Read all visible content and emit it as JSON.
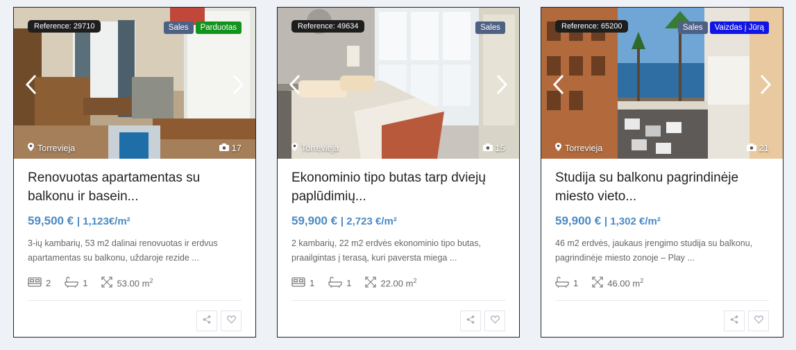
{
  "listings": [
    {
      "reference": "Reference: 29710",
      "tags": [
        "Sales",
        "Parduotas"
      ],
      "location": "Torrevieja",
      "photo_count": "17",
      "title": "Renovuotas apartamentas su balkonu ir basein...",
      "price": "59,500 €",
      "price_per_sqm": "| 1,123€/m²",
      "description": "3-ių kambarių, 53 m2 dalinai renovuotas ir erdvus apartamentas su balkonu, uždaroje rezide ...",
      "bedrooms": "2",
      "bathrooms": "1",
      "area": "53.00 m",
      "area_sup": "2"
    },
    {
      "reference": "Reference: 49634",
      "tags": [
        "Sales"
      ],
      "location": "Torrevieja",
      "photo_count": "15",
      "title": "Ekonominio tipo butas tarp dviejų paplūdimių...",
      "price": "59,900 €",
      "price_per_sqm": "| 2,723 €/m²",
      "description": "2 kambarių, 22 m2 erdvės ekonominio tipo butas, praailgintas į terasą, kuri paversta miega ...",
      "bedrooms": "1",
      "bathrooms": "1",
      "area": "22.00 m",
      "area_sup": "2"
    },
    {
      "reference": "Reference: 65200",
      "tags": [
        "Sales",
        "Vaizdas į Jūrą"
      ],
      "location": "Torrevieja",
      "photo_count": "21",
      "title": "Studija su balkonu pagrindinėje miesto vieto...",
      "price": "59,900 €",
      "price_per_sqm": "| 1,302 €/m²",
      "description": "46 m2 erdvės, jaukaus įrengimo studija su balkonu, pagrindinėje miesto zonoje – Play ...",
      "bathrooms": "1",
      "area": "46.00 m",
      "area_sup": "2"
    }
  ],
  "colors": {
    "price": "#4a8ac4",
    "tag_sales": "#4e6185",
    "tag_sold": "#11931c",
    "tag_sea_view": "#1015e6"
  },
  "icons": [
    "chevron-left-icon",
    "chevron-right-icon",
    "map-pin-icon",
    "camera-icon",
    "bed-icon",
    "bath-icon",
    "area-icon",
    "share-icon",
    "heart-icon"
  ]
}
